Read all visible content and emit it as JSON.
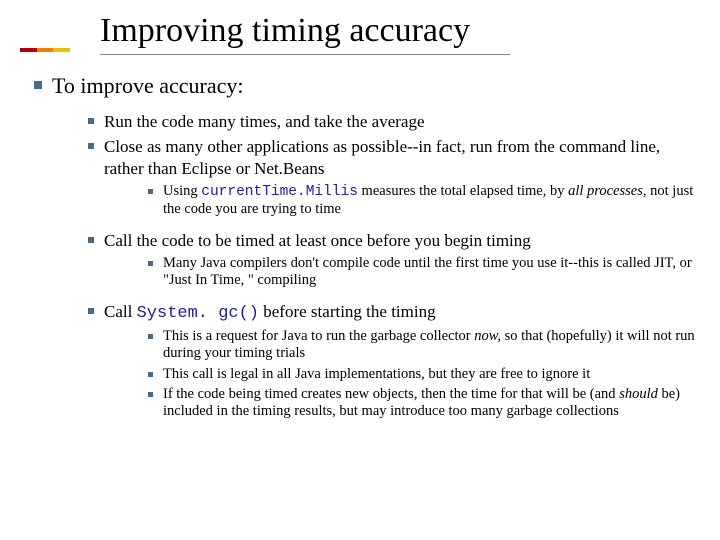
{
  "title": "Improving timing accuracy",
  "lvl1": "To improve accuracy:",
  "b1": "Run the code many times, and take the average",
  "b2": "Close as many other applications as possible--in fact, run from the command line, rather than Eclipse or Net.Beans",
  "b2_1a": "Using ",
  "b2_1code": "currentTime.Millis",
  "b2_1b": " measures the total elapsed time, by ",
  "b2_1ital": "all processes,",
  "b2_1c": " not just the code you are trying to time",
  "b3": "Call the code to be timed at least once before you begin timing",
  "b3_1": "Many Java compilers don't compile code until the first time you use it--this is called JIT, or \"Just In Time, \" compiling",
  "b4a": "Call ",
  "b4code": "System. gc()",
  "b4b": " before starting the timing",
  "b4_1a": "This is a request for Java to run the garbage collector ",
  "b4_1ital": "now,",
  "b4_1b": " so that (hopefully) it will not run during your timing trials",
  "b4_2": "This call is legal in all Java implementations, but they are free to ignore it",
  "b4_3a": "If the code being timed creates new objects, then the time for that will be (and ",
  "b4_3ital": "should",
  "b4_3b": " be) included in the timing results, but may introduce too many garbage collections"
}
